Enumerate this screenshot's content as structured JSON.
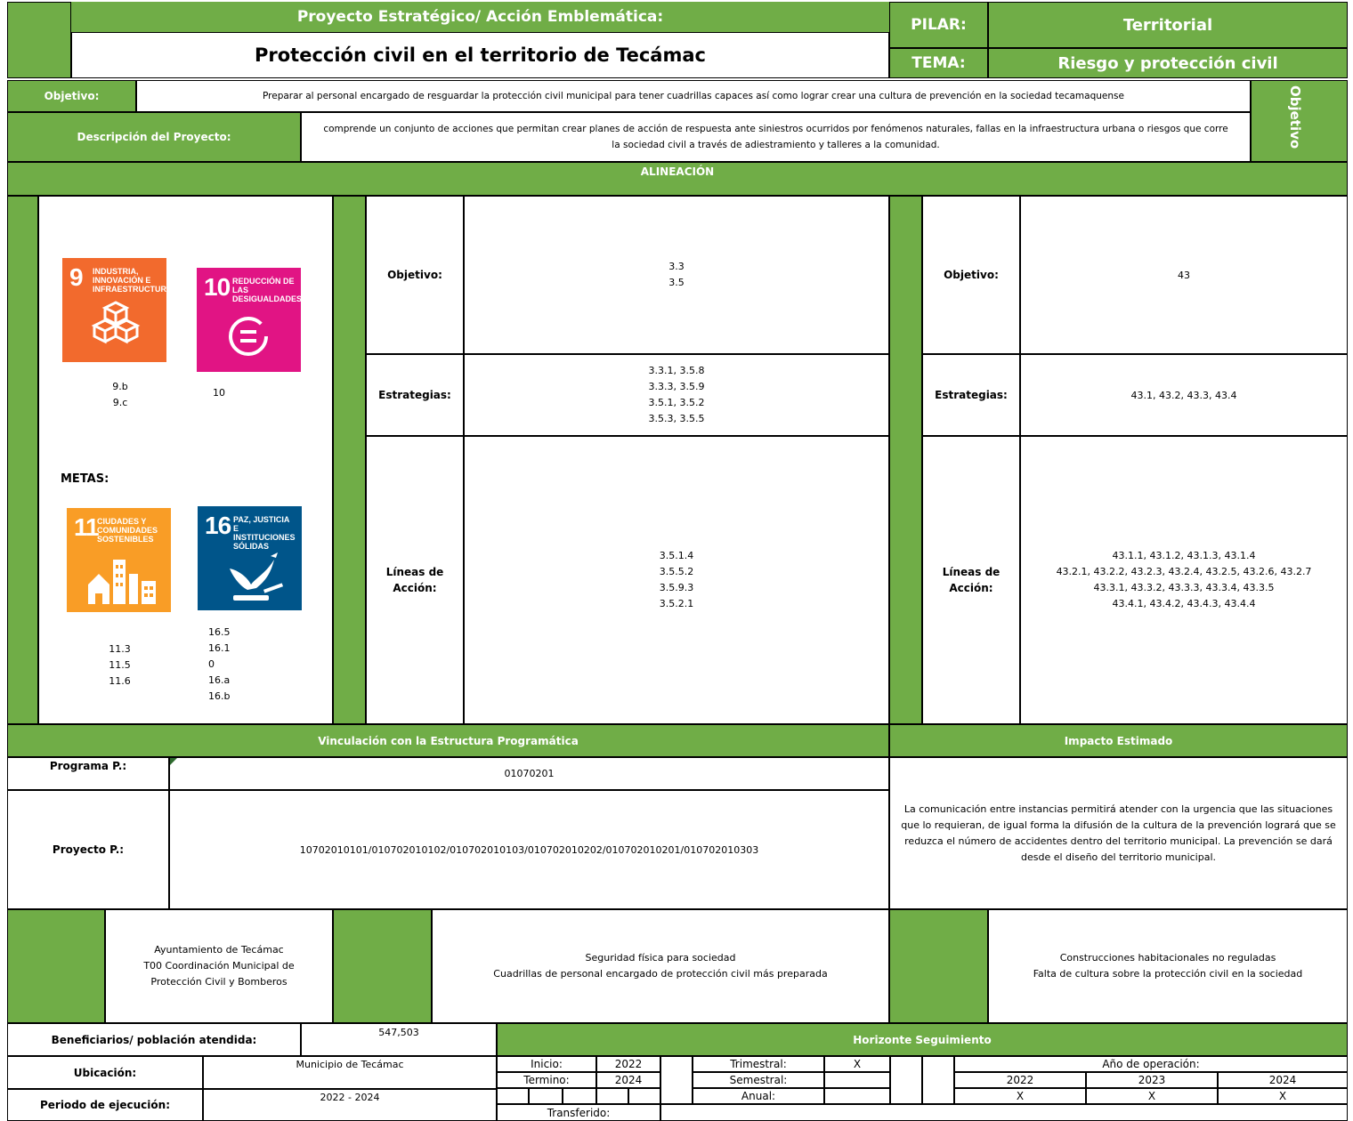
{
  "header": {
    "project_label": "Proyecto Estratégico/ Acción Emblemática:",
    "project_title": "Protección civil en el territorio de Tecámac",
    "pilar_label": "PILAR:",
    "pilar_value": "Territorial",
    "tema_label": "TEMA:",
    "tema_value": "Riesgo y protección civil"
  },
  "objective": {
    "label": "Objetivo:",
    "text": "Preparar al personal encargado de resguardar la protección civil municipal para tener cuadrillas capaces así como lograr crear una cultura de prevención en la sociedad tecamaquense",
    "vertical_label": "Objetivo"
  },
  "description": {
    "label": "Descripción del Proyecto:",
    "text": "comprende un conjunto de acciones que permitan crear planes de acción de respuesta ante siniestros ocurridos por fenómenos naturales, fallas en la infraestructura urbana o riesgos que corre la sociedad civil a través de adiestramiento y talleres a la comunidad."
  },
  "alineacion": {
    "title": "ALINEACIÓN",
    "metas_label": "METAS:",
    "sdgs": [
      {
        "number": "9",
        "label": "INDUSTRIA,\nINNOVACIÓN E\nINFRAESTRUCTURA",
        "color": "#f26a2d",
        "targets": "9.b\n9.c"
      },
      {
        "number": "10",
        "label": "REDUCCIÓN DE LAS\nDESIGUALDADES",
        "color": "#e11484",
        "targets": "10"
      },
      {
        "number": "11",
        "label": "CIUDADES Y\nCOMUNIDADES\nSOSTENIBLES",
        "color": "#f99d26",
        "targets": "11.3\n11.5\n11.6"
      },
      {
        "number": "16",
        "label": "PAZ, JUSTICIA\nE INSTITUCIONES\nSÓLIDAS",
        "color": "#00558a",
        "targets": "16.5\n16.1\n0\n16.a\n16.b"
      }
    ],
    "mid": {
      "objetivo_label": "Objetivo:",
      "objetivo_value": "3.3\n3.5",
      "estrategias_label": "Estrategias:",
      "estrategias_value": "3.3.1, 3.5.8\n3.3.3, 3.5.9\n3.5.1, 3.5.2\n3.5.3, 3.5.5",
      "lineas_label": "Líneas de\nAcción:",
      "lineas_value": "3.5.1.4\n3.5.5.2\n3.5.9.3\n3.5.2.1"
    },
    "right": {
      "objetivo_label": "Objetivo:",
      "objetivo_value": "43",
      "estrategias_label": "Estrategias:",
      "estrategias_value": "43.1, 43.2, 43.3, 43.4",
      "lineas_label": "Líneas de\nAcción:",
      "lineas_value": "43.1.1, 43.1.2, 43.1.3, 43.1.4\n43.2.1, 43.2.2, 43.2.3, 43.2.4, 43.2.5, 43.2.6, 43.2.7\n43.3.1, 43.3.2, 43.3.3, 43.3.4, 43.3.5\n43.4.1, 43.4.2, 43.4.3, 43.4.4"
    }
  },
  "vinculacion": {
    "title": "Vinculación con la  Estructura Programática",
    "programa_label": "Programa P.:",
    "programa_value": "01070201",
    "proyecto_label": "Proyecto P.:",
    "proyecto_value": "10702010101/010702010102/010702010103/010702010202/010702010201/010702010303"
  },
  "impacto": {
    "title": "Impacto Estimado",
    "text": "La comunicación entre instancias permitirá atender con la urgencia que las situaciones que lo requieran, de igual forma la difusión de la cultura de la prevención logrará que se reduzca el número de accidentes dentro del territorio municipal. La prevención se dará desde el diseño del territorio municipal."
  },
  "middle_row": {
    "responsables": "Ayuntamiento de Tecámac\nT00 Coordinación Municipal de\nProtección Civil y Bomberos",
    "beneficios": "Seguridad física para sociedad\nCuadrillas de personal encargado de protección civil más preparada",
    "riesgos": "Construcciones habitacionales no reguladas\nFalta de cultura sobre la protección civil en la sociedad"
  },
  "footer": {
    "beneficiarios_label": "Beneficiarios/ población atendida:",
    "beneficiarios_value": "547,503",
    "ubicacion_label": "Ubicación:",
    "ubicacion_value": "Municipio de Tecámac",
    "periodo_label": "Periodo de ejecución:",
    "periodo_value": "2022 - 2024",
    "horizonte_title": "Horizonte Seguimiento",
    "inicio_label": "Inicio:",
    "inicio_value": "2022",
    "termino_label": "Termino:",
    "termino_value": "2024",
    "transferido_label": "Transferido:",
    "trimestral_label": "Trimestral:",
    "semestral_label": "Semestral:",
    "anual_label": "Anual:",
    "trimestral_mark": "X",
    "anio_label": "Año de operación:",
    "years": [
      "2022",
      "2023",
      "2024"
    ],
    "year_marks": [
      "X",
      "X",
      "X"
    ]
  }
}
